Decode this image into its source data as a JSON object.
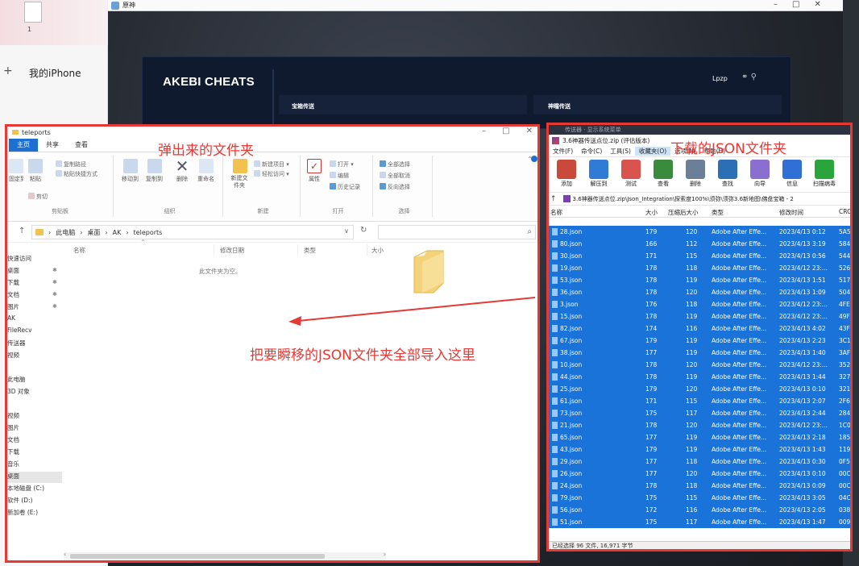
{
  "background": {
    "doc_label": "1",
    "phone_name": "我的iPhone",
    "plus_symbol": "+",
    "game_window_title": "原神",
    "akebi": {
      "title": "AKEBI CHEATS",
      "user": "Lpzp",
      "left_tab": "宝箱传送",
      "right_tab": "神瞳传送"
    }
  },
  "explorer": {
    "title": "teleports",
    "tabs": [
      {
        "label": "主页",
        "active": true
      },
      {
        "label": "共享",
        "active": false
      },
      {
        "label": "查看",
        "active": false
      }
    ],
    "ribbon": {
      "clipboard": {
        "group": "剪贴板",
        "fixed": "固定到快速访问",
        "copy": "复制",
        "paste": "粘贴",
        "copy_path": "复制路径",
        "paste_shortcut": "粘贴快捷方式",
        "cut": "剪切"
      },
      "organize": {
        "group": "组织",
        "move_to": "移动到",
        "copy_to": "复制到",
        "delete": "删除",
        "rename": "重命名"
      },
      "new": {
        "group": "新建",
        "new_folder": "新建文件夹",
        "new_item": "新建项目",
        "easy_access": "轻松访问"
      },
      "open": {
        "group": "打开",
        "properties": "属性",
        "open": "打开",
        "edit": "编辑",
        "history": "历史记录"
      },
      "select": {
        "group": "选择",
        "select_all": "全部选择",
        "select_none": "全部取消",
        "invert": "反向选择"
      }
    },
    "address": [
      "此电脑",
      "桌面",
      "AK",
      "teleports"
    ],
    "columns": [
      "名称",
      "修改日期",
      "类型",
      "大小"
    ],
    "empty_message": "此文件夹为空。",
    "nav_items": [
      {
        "label": "快速访问",
        "pinned": false,
        "selected": false
      },
      {
        "label": "桌面",
        "pinned": true,
        "selected": false
      },
      {
        "label": "下载",
        "pinned": true,
        "selected": false
      },
      {
        "label": "文档",
        "pinned": true,
        "selected": false
      },
      {
        "label": "图片",
        "pinned": true,
        "selected": false
      },
      {
        "label": "AK",
        "pinned": false,
        "selected": false
      },
      {
        "label": "FileRecv",
        "pinned": false,
        "selected": false
      },
      {
        "label": "传送器",
        "pinned": false,
        "selected": false
      },
      {
        "label": "视频",
        "pinned": false,
        "selected": false
      },
      {
        "label": "",
        "pinned": false,
        "selected": false
      },
      {
        "label": "此电脑",
        "pinned": false,
        "selected": false
      },
      {
        "label": "3D 对象",
        "pinned": false,
        "selected": false
      },
      {
        "label": "",
        "pinned": false,
        "selected": false
      },
      {
        "label": "视频",
        "pinned": false,
        "selected": false
      },
      {
        "label": "图片",
        "pinned": false,
        "selected": false
      },
      {
        "label": "文档",
        "pinned": false,
        "selected": false
      },
      {
        "label": "下载",
        "pinned": false,
        "selected": false
      },
      {
        "label": "音乐",
        "pinned": false,
        "selected": false
      },
      {
        "label": "桌面",
        "pinned": false,
        "selected": true
      },
      {
        "label": "本地磁盘 (C:)",
        "pinned": false,
        "selected": false
      },
      {
        "label": "软件 (D:)",
        "pinned": false,
        "selected": false
      },
      {
        "label": "新加卷 (E:)",
        "pinned": false,
        "selected": false
      }
    ]
  },
  "zip": {
    "caption_strip": "传送器 · 显示系统菜单",
    "title": "3.6神器传送点位.zip (评估版本)",
    "menu": [
      {
        "label": "文件(F)",
        "hl": false
      },
      {
        "label": "命令(C)",
        "hl": false
      },
      {
        "label": "工具(S)",
        "hl": false
      },
      {
        "label": "收藏夹(O)",
        "hl": true
      },
      {
        "label": "选项(N)",
        "hl": false
      },
      {
        "label": "帮助(H)",
        "hl": false
      }
    ],
    "toolbar": [
      {
        "label": "添加",
        "name": "add",
        "color": "#c94a3a"
      },
      {
        "label": "解压到",
        "name": "extract",
        "color": "#2f7bd6"
      },
      {
        "label": "测试",
        "name": "test",
        "color": "#d9534f"
      },
      {
        "label": "查看",
        "name": "view",
        "color": "#3b8a3e"
      },
      {
        "label": "删除",
        "name": "delete",
        "color": "#6b7f99"
      },
      {
        "label": "查找",
        "name": "find",
        "color": "#2d6fb6"
      },
      {
        "label": "向导",
        "name": "wizard",
        "color": "#8a6fd1"
      },
      {
        "label": "信息",
        "name": "info",
        "color": "#2f6fd6"
      },
      {
        "label": "扫描病毒",
        "name": "scan",
        "color": "#2aa53b"
      }
    ],
    "path": "3.6神器传送点位.zip\\Json_Integration\\探索度100%\\须弥\\须弥3.6新地图\\佛盘宝箱 - 2",
    "columns": [
      "名称",
      "大小",
      "压缩后大小",
      "类型",
      "修改时间",
      "CRC"
    ],
    "rows": [
      {
        "name": "28.json",
        "size": "179",
        "packed": "120",
        "type": "Adobe After Effe...",
        "time": "2023/4/13 0:12",
        "crc": "5A5"
      },
      {
        "name": "80.json",
        "size": "166",
        "packed": "112",
        "type": "Adobe After Effe...",
        "time": "2023/4/13 3:19",
        "crc": "584"
      },
      {
        "name": "30.json",
        "size": "171",
        "packed": "115",
        "type": "Adobe After Effe...",
        "time": "2023/4/13 0:56",
        "crc": "544"
      },
      {
        "name": "19.json",
        "size": "178",
        "packed": "118",
        "type": "Adobe After Effe...",
        "time": "2023/4/12 23:...",
        "crc": "526"
      },
      {
        "name": "53.json",
        "size": "178",
        "packed": "119",
        "type": "Adobe After Effe...",
        "time": "2023/4/13 1:51",
        "crc": "517"
      },
      {
        "name": "36.json",
        "size": "178",
        "packed": "120",
        "type": "Adobe After Effe...",
        "time": "2023/4/13 1:09",
        "crc": "504"
      },
      {
        "name": "3.json",
        "size": "176",
        "packed": "118",
        "type": "Adobe After Effe...",
        "time": "2023/4/12 23:...",
        "crc": "4FE"
      },
      {
        "name": "15.json",
        "size": "178",
        "packed": "119",
        "type": "Adobe After Effe...",
        "time": "2023/4/12 23:...",
        "crc": "49F"
      },
      {
        "name": "82.json",
        "size": "174",
        "packed": "116",
        "type": "Adobe After Effe...",
        "time": "2023/4/13 4:02",
        "crc": "43F"
      },
      {
        "name": "67.json",
        "size": "179",
        "packed": "119",
        "type": "Adobe After Effe...",
        "time": "2023/4/13 2:23",
        "crc": "3C1"
      },
      {
        "name": "38.json",
        "size": "177",
        "packed": "119",
        "type": "Adobe After Effe...",
        "time": "2023/4/13 1:40",
        "crc": "3AF"
      },
      {
        "name": "10.json",
        "size": "178",
        "packed": "120",
        "type": "Adobe After Effe...",
        "time": "2023/4/12 23:...",
        "crc": "352"
      },
      {
        "name": "44.json",
        "size": "178",
        "packed": "119",
        "type": "Adobe After Effe...",
        "time": "2023/4/13 1:44",
        "crc": "327"
      },
      {
        "name": "25.json",
        "size": "179",
        "packed": "120",
        "type": "Adobe After Effe...",
        "time": "2023/4/13 0:10",
        "crc": "321"
      },
      {
        "name": "61.json",
        "size": "171",
        "packed": "115",
        "type": "Adobe After Effe...",
        "time": "2023/4/13 2:07",
        "crc": "2F6"
      },
      {
        "name": "73.json",
        "size": "175",
        "packed": "117",
        "type": "Adobe After Effe...",
        "time": "2023/4/13 2:44",
        "crc": "284"
      },
      {
        "name": "21.json",
        "size": "178",
        "packed": "120",
        "type": "Adobe After Effe...",
        "time": "2023/4/12 23:...",
        "crc": "1C0"
      },
      {
        "name": "65.json",
        "size": "177",
        "packed": "119",
        "type": "Adobe After Effe...",
        "time": "2023/4/13 2:18",
        "crc": "185"
      },
      {
        "name": "43.json",
        "size": "179",
        "packed": "119",
        "type": "Adobe After Effe...",
        "time": "2023/4/13 1:43",
        "crc": "119"
      },
      {
        "name": "29.json",
        "size": "177",
        "packed": "118",
        "type": "Adobe After Effe...",
        "time": "2023/4/13 0:30",
        "crc": "0F5"
      },
      {
        "name": "26.json",
        "size": "177",
        "packed": "120",
        "type": "Adobe After Effe...",
        "time": "2023/4/13 0:10",
        "crc": "00C"
      },
      {
        "name": "24.json",
        "size": "178",
        "packed": "118",
        "type": "Adobe After Effe...",
        "time": "2023/4/13 0:09",
        "crc": "00C"
      },
      {
        "name": "79.json",
        "size": "175",
        "packed": "115",
        "type": "Adobe After Effe...",
        "time": "2023/4/13 3:05",
        "crc": "04C"
      },
      {
        "name": "56.json",
        "size": "172",
        "packed": "116",
        "type": "Adobe After Effe...",
        "time": "2023/4/13 2:05",
        "crc": "038"
      },
      {
        "name": "51.json",
        "size": "175",
        "packed": "117",
        "type": "Adobe After Effe...",
        "time": "2023/4/13 1:47",
        "crc": "009"
      }
    ],
    "status": "已经选择 96 文件, 16,971 字节"
  },
  "annotations": {
    "popup_folder": "弹出来的文件夹",
    "downloaded_folder": "下载的JSON文件夹",
    "instruction": "把要瞬移的JSON文件夹全部导入这里",
    "color": "#e53935"
  }
}
